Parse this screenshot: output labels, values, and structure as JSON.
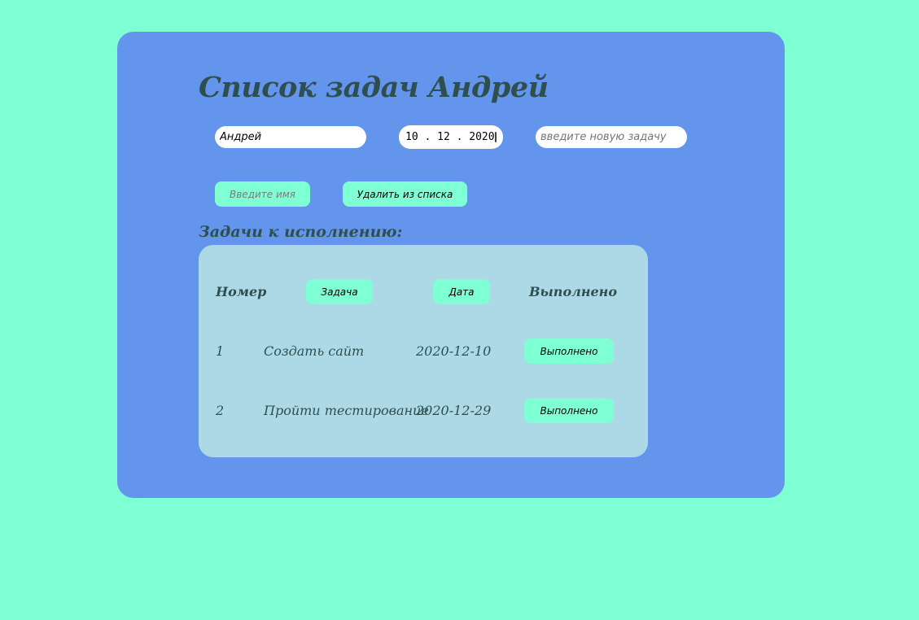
{
  "header": {
    "title": "Список задач Андрей"
  },
  "form": {
    "name_value": "Андрей",
    "date_value": "10 . 12 . 2020",
    "task_placeholder": "введите новую задачу",
    "name_button_label": "Введите имя",
    "delete_button_label": "Удалить из списка"
  },
  "tasks_section": {
    "title": "Задачи к исполнению:",
    "headers": {
      "number": "Номер",
      "task": "Задача",
      "date": "Дата",
      "done": "Выполнено"
    },
    "rows": [
      {
        "number": "1",
        "task": "Создать сайт",
        "date": "2020-12-10",
        "done_label": "Выполнено"
      },
      {
        "number": "2",
        "task": "Пройти тестирование",
        "date": "2020-12-29",
        "done_label": "Выполнено"
      }
    ]
  },
  "colors": {
    "page_background": "#7fffd4",
    "card_background": "#6495ed",
    "table_background": "#add8e6",
    "button_background": "#7fffd4",
    "heading_text": "#2f4f4f"
  },
  "icons": {
    "date_picker": "calendar-icon"
  }
}
